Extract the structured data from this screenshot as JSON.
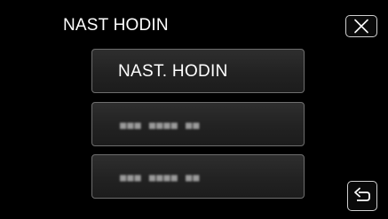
{
  "header": {
    "title": "NAST HODIN",
    "close_icon": "close-icon"
  },
  "menu": {
    "items": [
      {
        "label": "NAST. HODIN",
        "state": "selected"
      },
      {
        "label": "■■■ ■■■■ ■■",
        "state": "blurred"
      },
      {
        "label": "■■■ ■■■■ ■■",
        "state": "blurred"
      }
    ]
  },
  "footer": {
    "back_icon": "return-arrow-icon"
  },
  "colors": {
    "background": "#000000",
    "button_fill": "#262626",
    "button_border": "#6e6e6e",
    "text": "#ffffff"
  }
}
